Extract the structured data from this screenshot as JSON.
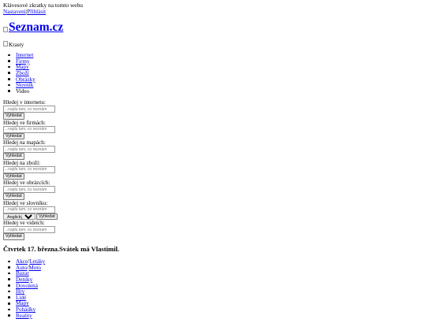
{
  "header": {
    "shortcuts_text": "Klávesové zkratky na tomto webu",
    "settings_link": "Nastavení",
    "login_link": "Přihlásit"
  },
  "logo": {
    "alt_text": "Seznam.cz"
  },
  "promo": {
    "alt_text": "Krasty"
  },
  "tabs": [
    {
      "label": "Internet",
      "is_link": true
    },
    {
      "label": "Firmy",
      "is_link": true
    },
    {
      "label": "Mapy",
      "is_link": true
    },
    {
      "label": "Zboží",
      "is_link": true
    },
    {
      "label": "Obrázky",
      "is_link": true
    },
    {
      "label": "Slovník",
      "is_link": true
    },
    {
      "label": "Video",
      "is_link": false
    }
  ],
  "search_forms": [
    {
      "label": "Hledej v internetu:",
      "placeholder": "...najdu tam, co neznám",
      "button": "Vyhledat"
    },
    {
      "label": "Hledej ve firmách:",
      "placeholder": "...najdu tam, co neznám",
      "button": "Vyhledat"
    },
    {
      "label": "Hledej na mapách:",
      "placeholder": "...najdu tam, co neznám",
      "button": "Vyhledat"
    },
    {
      "label": "Hledej na zboží:",
      "placeholder": "...najdu tam, co neznám",
      "button": "Vyhledat"
    },
    {
      "label": "Hledej ve obrázcích:",
      "placeholder": "...najdu tam, co neznám",
      "button": "Vyhledat"
    },
    {
      "label": "Hledej ve slovníku:",
      "placeholder": "...najdu tam, co neznám",
      "button": "Vyhledat",
      "language_select": "Anglický"
    },
    {
      "label": "Hledej ve videích:",
      "placeholder": "...najdu tam, co neznám",
      "button": "Vyhledat"
    }
  ],
  "date_heading": "Čtvrtek 17. března.Svátek má Vlastimil.",
  "categories": [
    {
      "parts": [
        "Akce",
        "Letáky"
      ]
    },
    {
      "parts": [
        "Auto",
        "Moto"
      ]
    },
    {
      "parts": [
        "Bazar"
      ]
    },
    {
      "parts": [
        "Deníky"
      ]
    },
    {
      "parts": [
        "Dovolená"
      ]
    },
    {
      "parts": [
        "Hry"
      ]
    },
    {
      "parts": [
        "Lidé"
      ]
    },
    {
      "parts": [
        "Mapy"
      ]
    },
    {
      "parts": [
        "Pohádky"
      ]
    },
    {
      "parts": [
        "Reality"
      ]
    }
  ]
}
